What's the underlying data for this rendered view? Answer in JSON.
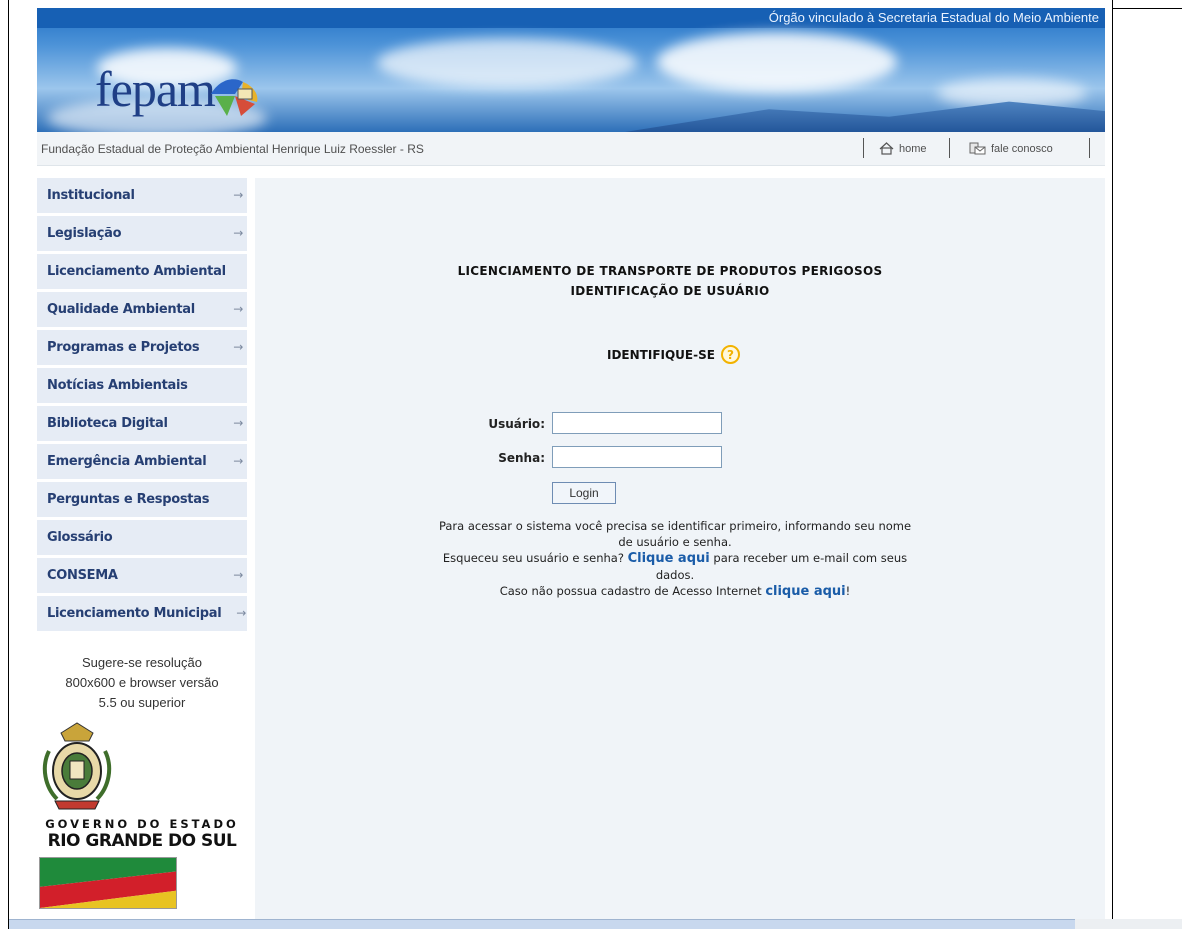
{
  "header": {
    "tagline": "Órgão vinculado à Secretaria Estadual do Meio Ambiente",
    "logo_text": "fepam",
    "org_name": "Fundação Estadual de Proteção Ambiental Henrique Luiz Roessler - RS",
    "home_label": "home",
    "contact_label": "fale conosco"
  },
  "sidebar": {
    "items": [
      {
        "label": "Institucional",
        "arrow": "→"
      },
      {
        "label": "Legislação",
        "arrow": "→"
      },
      {
        "label": "Licenciamento Ambiental",
        "arrow": ""
      },
      {
        "label": "Qualidade Ambiental",
        "arrow": "→"
      },
      {
        "label": "Programas e Projetos",
        "arrow": "→"
      },
      {
        "label": "Notícias Ambientais",
        "arrow": ""
      },
      {
        "label": "Biblioteca Digital",
        "arrow": "→"
      },
      {
        "label": "Emergência Ambiental",
        "arrow": "→"
      },
      {
        "label": "Perguntas e Respostas",
        "arrow": ""
      },
      {
        "label": "Glossário",
        "arrow": ""
      },
      {
        "label": "CONSEMA",
        "arrow": "→"
      },
      {
        "label": "Licenciamento Municipal",
        "arrow": "→"
      }
    ],
    "note_line1": "Sugere-se resolução",
    "note_line2": "800x600 e browser versão",
    "note_line3": "5.5 ou superior",
    "gov_line1": "GOVERNO DO ESTADO",
    "gov_line2": "RIO GRANDE DO SUL"
  },
  "main": {
    "title_line1": "LICENCIAMENTO DE TRANSPORTE DE PRODUTOS PERIGOSOS",
    "title_line2": "IDENTIFICAÇÃO DE USUÁRIO",
    "identify_label": "IDENTIFIQUE-SE",
    "help_icon": "?",
    "username_label": "Usuário",
    "password_label": "Senha",
    "username_value": "",
    "password_value": "",
    "login_button": "Login",
    "info_line1": "Para acessar o sistema você precisa se identificar primeiro, informando seu nome",
    "info_line2": "de usuário e senha.",
    "forgot_prefix": "Esqueceu seu usuário e senha?",
    "forgot_link": "Clique aqui",
    "forgot_suffix": "para receber um e-mail com seus",
    "forgot_suffix2": "dados.",
    "register_prefix": "Caso não possua cadastro de Acesso Internet",
    "register_link": "clique aqui",
    "register_suffix": "!"
  },
  "colors": {
    "menu_bg": "#e6ecf5",
    "menu_text": "#263f73",
    "content_bg": "#f0f4f8",
    "link": "#1a5ca8",
    "banner_top": "#1760b4"
  },
  "icons": [
    "home-icon",
    "contact-icon",
    "help-icon",
    "arrow-right-icon"
  ]
}
